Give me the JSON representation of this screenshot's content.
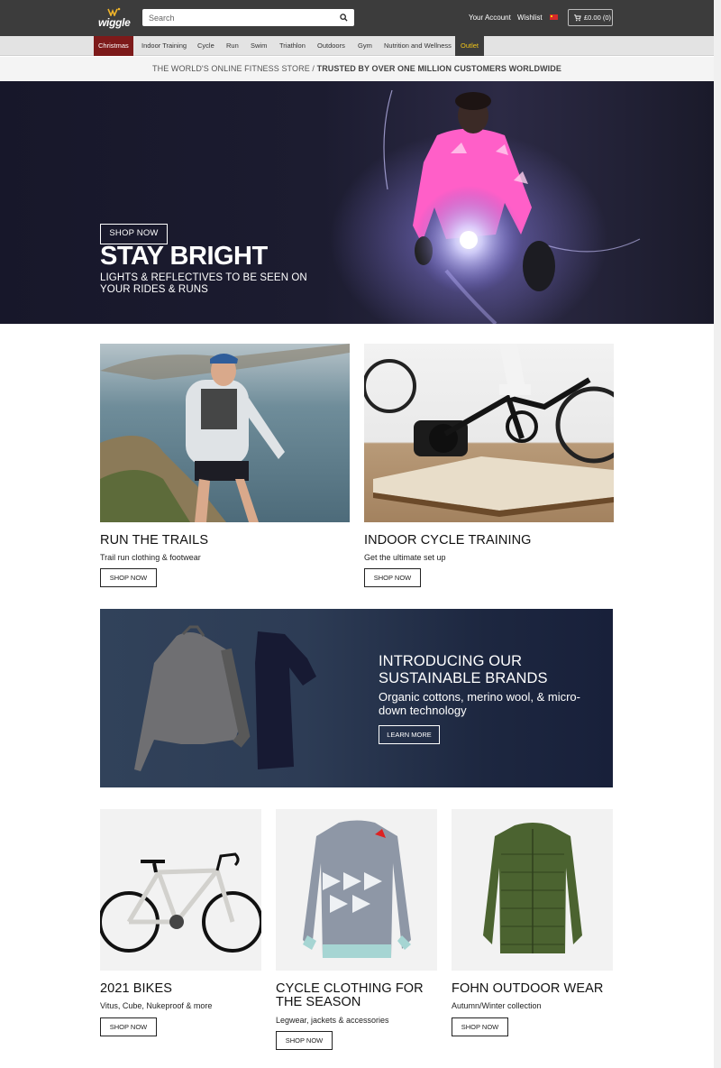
{
  "header": {
    "logo_text": "wiggle",
    "search_placeholder": "Search",
    "account_label": "Your Account",
    "wishlist_label": "Wishlist",
    "basket_label": "£0.00 (0)"
  },
  "nav": {
    "items": [
      {
        "label": "Christmas"
      },
      {
        "label": "Indoor Training"
      },
      {
        "label": "Cycle"
      },
      {
        "label": "Run"
      },
      {
        "label": "Swim"
      },
      {
        "label": "Triathlon"
      },
      {
        "label": "Outdoors"
      },
      {
        "label": "Gym"
      },
      {
        "label": "Nutrition and Wellness"
      },
      {
        "label": "Outlet"
      }
    ]
  },
  "tagline": {
    "part1": "THE WORLD'S ONLINE FITNESS STORE / ",
    "part2": "TRUSTED BY OVER ONE MILLION CUSTOMERS WORLDWIDE"
  },
  "hero": {
    "title": "STAY BRIGHT",
    "subtitle": "LIGHTS & REFLECTIVES TO BE SEEN ON YOUR RIDES & RUNS",
    "button": "SHOP NOW"
  },
  "feature_cards": [
    {
      "title": "RUN THE TRAILS",
      "subtitle": "Trail run clothing & footwear",
      "button": "SHOP NOW"
    },
    {
      "title": "INDOOR CYCLE TRAINING",
      "subtitle": "Get the ultimate set up",
      "button": "SHOP NOW"
    }
  ],
  "promo": {
    "title": "INTRODUCING OUR SUSTAINABLE BRANDS",
    "subtitle": "Organic cottons, merino wool, & micro-down technology",
    "button": "LEARN MORE"
  },
  "product_cards": [
    {
      "title": "2021 BIKES",
      "subtitle": "Vitus, Cube, Nukeproof & more",
      "button": "SHOP NOW"
    },
    {
      "title": "CYCLE CLOTHING FOR THE SEASON",
      "subtitle": "Legwear, jackets & accessories",
      "button": "SHOP NOW"
    },
    {
      "title": "FOHN OUTDOOR WEAR",
      "subtitle": "Autumn/Winter collection",
      "button": "SHOP NOW"
    }
  ],
  "colors": {
    "header_bg": "#3c3c3c",
    "christmas_tab": "#7d1a1a",
    "outlet_text": "#f0c419"
  }
}
